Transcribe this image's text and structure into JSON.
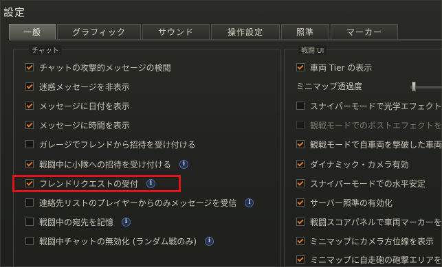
{
  "window": {
    "title": "設定"
  },
  "tabs": [
    {
      "label": "一般",
      "active": true
    },
    {
      "label": "グラフィック",
      "active": false
    },
    {
      "label": "サウンド",
      "active": false
    },
    {
      "label": "操作設定",
      "active": false
    },
    {
      "label": "照準",
      "active": false
    },
    {
      "label": "マーカー",
      "active": false
    }
  ],
  "chat_section": {
    "title": "チャット",
    "options": [
      {
        "label": "チャットの攻撃的メッセージの検閲",
        "checked": true,
        "info": false
      },
      {
        "label": "迷惑メッセージを非表示",
        "checked": true,
        "info": false
      },
      {
        "label": "メッセージに日付を表示",
        "checked": true,
        "info": false
      },
      {
        "label": "メッセージに時間を表示",
        "checked": true,
        "info": false
      },
      {
        "label": "ガレージでフレンドから招待を受け付ける",
        "checked": false,
        "info": false
      },
      {
        "label": "戦闘中に小隊への招待を受け付ける",
        "checked": true,
        "info": true
      },
      {
        "label": "フレンドリクエストの受付",
        "checked": true,
        "info": true
      },
      {
        "label": "連絡先リストのプレイヤーからのみメッセージを受信",
        "checked": false,
        "info": true
      },
      {
        "label": "戦闘中の宛先を記憶",
        "checked": false,
        "info": true
      },
      {
        "label": "戦闘中チャットの無効化 (ランダム戦のみ)",
        "checked": false,
        "info": true
      }
    ]
  },
  "battle_ui_section": {
    "title": "戦闘 UI",
    "minimap_transparency_label": "ミニマップ透過度",
    "options": [
      {
        "label": "車両 Tier の表示",
        "checked": true,
        "disabled": false
      },
      {
        "label": "スナイパーモードで光学エフェクトを",
        "checked": false,
        "disabled": false
      },
      {
        "label": "観戦モードでのポストエフェクトを有",
        "checked": false,
        "disabled": true
      },
      {
        "label": "観戦モードで自車両を撃破した車両",
        "checked": true,
        "disabled": false
      },
      {
        "label": "ダイナミック・カメラ有効",
        "checked": true,
        "disabled": false
      },
      {
        "label": "スナイパーモードでの水平安定",
        "checked": true,
        "disabled": false
      },
      {
        "label": "サーバー照準の有効化",
        "checked": true,
        "disabled": false
      },
      {
        "label": "戦闘スコアパネルで車両マーカーを",
        "checked": true,
        "disabled": false
      },
      {
        "label": "ミニマップにカメラ方位線を表示",
        "checked": true,
        "disabled": false
      },
      {
        "label": "ミニマップに自走砲の砲撃エリアを",
        "checked": true,
        "disabled": false
      }
    ]
  },
  "info_icon_glyph": "i",
  "colors": {
    "accent_check": "#e07b2a",
    "highlight_box": "#e3131b",
    "info_icon": "#4f6aa5"
  }
}
